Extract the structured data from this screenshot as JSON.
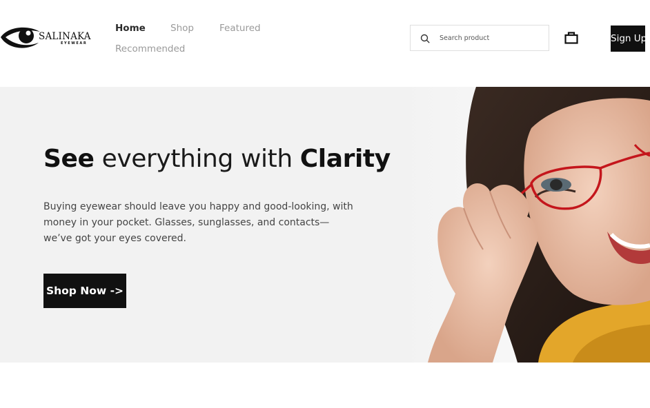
{
  "brand": {
    "name": "SALINAKA",
    "tagline": "EYEWEAR"
  },
  "nav": {
    "items": [
      {
        "label": "Home",
        "active": true
      },
      {
        "label": "Shop",
        "active": false
      },
      {
        "label": "Featured",
        "active": false
      },
      {
        "label": "Recommended",
        "active": false
      }
    ]
  },
  "search": {
    "placeholder": "Search product",
    "icon": "search-icon"
  },
  "cart": {
    "icon": "shopping-bag-icon"
  },
  "auth": {
    "signup_label": "Sign Up"
  },
  "hero": {
    "title_bold_1": "See",
    "title_light": " everything with ",
    "title_bold_2": "Clarity",
    "description": "Buying eyewear should leave you happy and good-looking, with money in your pocket. Glasses, sunglasses, and contacts—we’ve got your eyes covered.",
    "cta_label": "Shop Now ->"
  },
  "colors": {
    "hero_bg": "#f2f2f2",
    "button_bg": "#101010",
    "active_nav": "#2b2b2b",
    "inactive_nav": "#9a9a9a",
    "glasses_frame": "#c4161c"
  }
}
